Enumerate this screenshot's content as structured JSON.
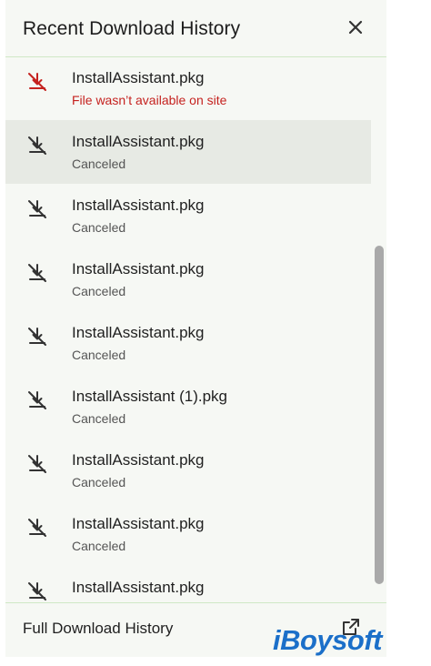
{
  "header": {
    "title": "Recent Download History",
    "close_icon": "close-icon"
  },
  "downloads": [
    {
      "name": "InstallAssistant.pkg",
      "status": "File wasn’t available on site",
      "state": "error"
    },
    {
      "name": "InstallAssistant.pkg",
      "status": "Canceled",
      "state": "canceled"
    },
    {
      "name": "InstallAssistant.pkg",
      "status": "Canceled",
      "state": "canceled"
    },
    {
      "name": "InstallAssistant.pkg",
      "status": "Canceled",
      "state": "canceled"
    },
    {
      "name": "InstallAssistant.pkg",
      "status": "Canceled",
      "state": "canceled"
    },
    {
      "name": "InstallAssistant (1).pkg",
      "status": "Canceled",
      "state": "canceled"
    },
    {
      "name": "InstallAssistant.pkg",
      "status": "Canceled",
      "state": "canceled"
    },
    {
      "name": "InstallAssistant.pkg",
      "status": "Canceled",
      "state": "canceled"
    },
    {
      "name": "InstallAssistant.pkg",
      "status": "",
      "state": "canceled"
    }
  ],
  "footer": {
    "label": "Full Download History",
    "open_icon": "open-in-new-icon"
  },
  "watermark": "iBoysoft",
  "colors": {
    "error": "#c5221f",
    "icon": "#333333",
    "accent_border": "#cfe8c6",
    "watermark": "#1b6fc9"
  }
}
